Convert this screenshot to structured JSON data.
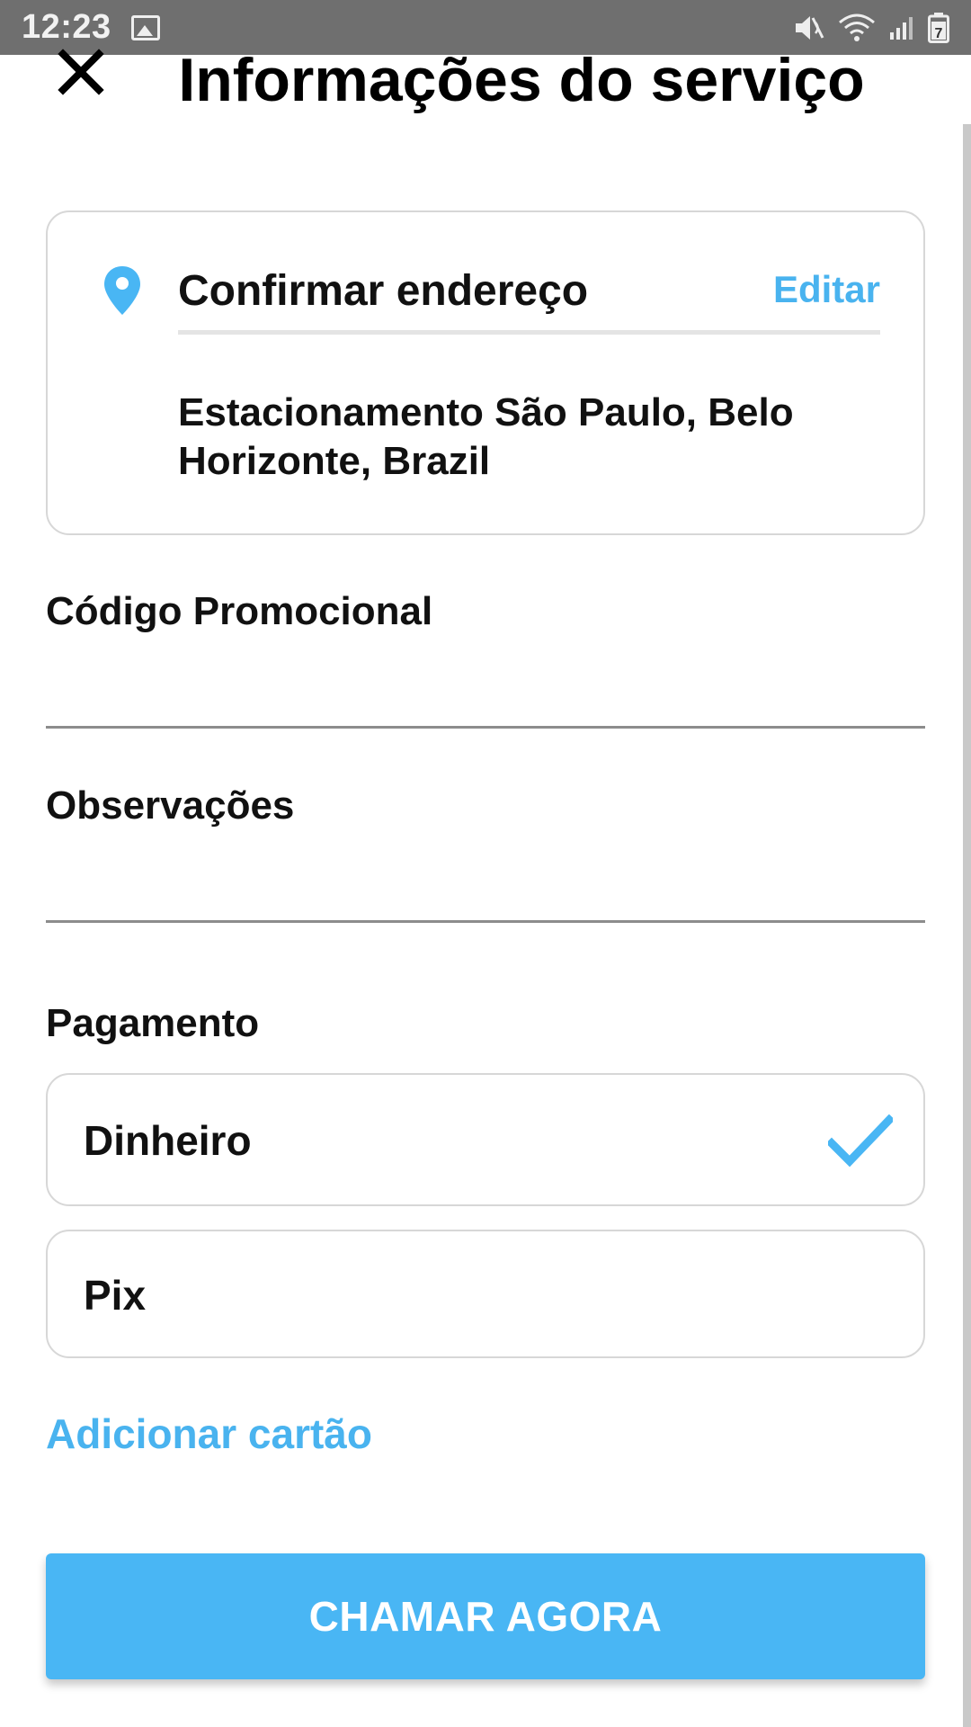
{
  "status_bar": {
    "time": "12:23",
    "icons": [
      "gallery-icon",
      "mute-icon",
      "wifi-icon",
      "signal-icon",
      "battery-icon"
    ],
    "battery_level": "7"
  },
  "header": {
    "title": "Informações do serviço",
    "close_icon": "close-icon"
  },
  "address_card": {
    "title": "Confirmar endereço",
    "edit_label": "Editar",
    "address": "Estacionamento São Paulo, Belo Horizonte, Brazil",
    "icon": "location-pin-icon"
  },
  "form": {
    "promo_label": "Código Promocional",
    "promo_value": "",
    "notes_label": "Observações",
    "notes_value": ""
  },
  "payment": {
    "title": "Pagamento",
    "options": [
      {
        "label": "Dinheiro",
        "selected": true
      },
      {
        "label": "Pix",
        "selected": false
      }
    ],
    "add_card_label": "Adicionar cartão"
  },
  "cta": {
    "label": "CHAMAR AGORA"
  },
  "colors": {
    "accent": "#49B6F4",
    "status_bar": "#6F6F6F",
    "border": "#D7D7D7",
    "text": "#111111"
  }
}
